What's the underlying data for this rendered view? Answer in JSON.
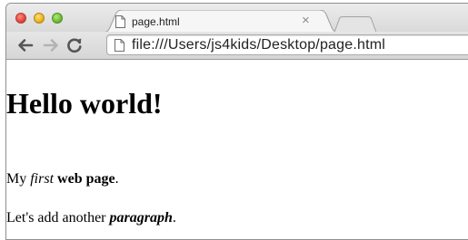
{
  "browser": {
    "tab": {
      "title": "page.html",
      "close_glyph": "×"
    },
    "address_bar": {
      "url": "file:///Users/js4kids/Desktop/page.html"
    },
    "icons": [
      "close-window-icon",
      "minimize-window-icon",
      "zoom-window-icon",
      "page-icon",
      "back-arrow-icon",
      "forward-arrow-icon",
      "reload-icon"
    ]
  },
  "page": {
    "heading": "Hello world!",
    "paragraph1": {
      "pre": "My ",
      "em": "first",
      "mid": " ",
      "strong": "web page",
      "post": "."
    },
    "paragraph2": {
      "pre": "Let's add another ",
      "strong_em": "paragraph",
      "post": "."
    }
  },
  "colors": {
    "close": "#e0443e",
    "minimize": "#e9b21b",
    "zoom": "#6cbd35"
  }
}
